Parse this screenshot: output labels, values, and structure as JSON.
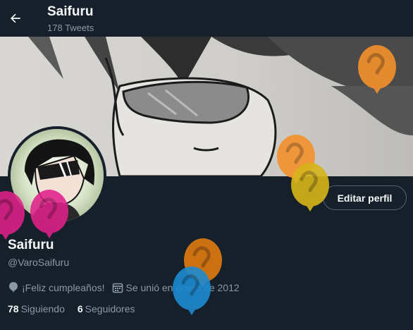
{
  "header": {
    "back_icon": "arrow-left-icon",
    "title": "Saifuru",
    "subtitle": "178 Tweets"
  },
  "profile": {
    "edit_label": "Editar perfil",
    "name": "Saifuru",
    "handle": "@VaroSaifuru",
    "birthday_icon": "balloon-icon",
    "birthday": "¡Feliz cumpleaños!",
    "joined_icon": "calendar-icon",
    "joined": "Se unió en enero de 2012",
    "following_count": "78",
    "following_label": "Siguiendo",
    "followers_count": "6",
    "followers_label": "Seguidores"
  },
  "colors": {
    "background": "#15202b",
    "text": "#f7f9f9",
    "muted": "#8b98a5",
    "balloon_orange": "#f4902c",
    "balloon_yellow": "#d7b51a",
    "balloon_pink": "#e0218a",
    "balloon_blue": "#1d8bd1"
  }
}
